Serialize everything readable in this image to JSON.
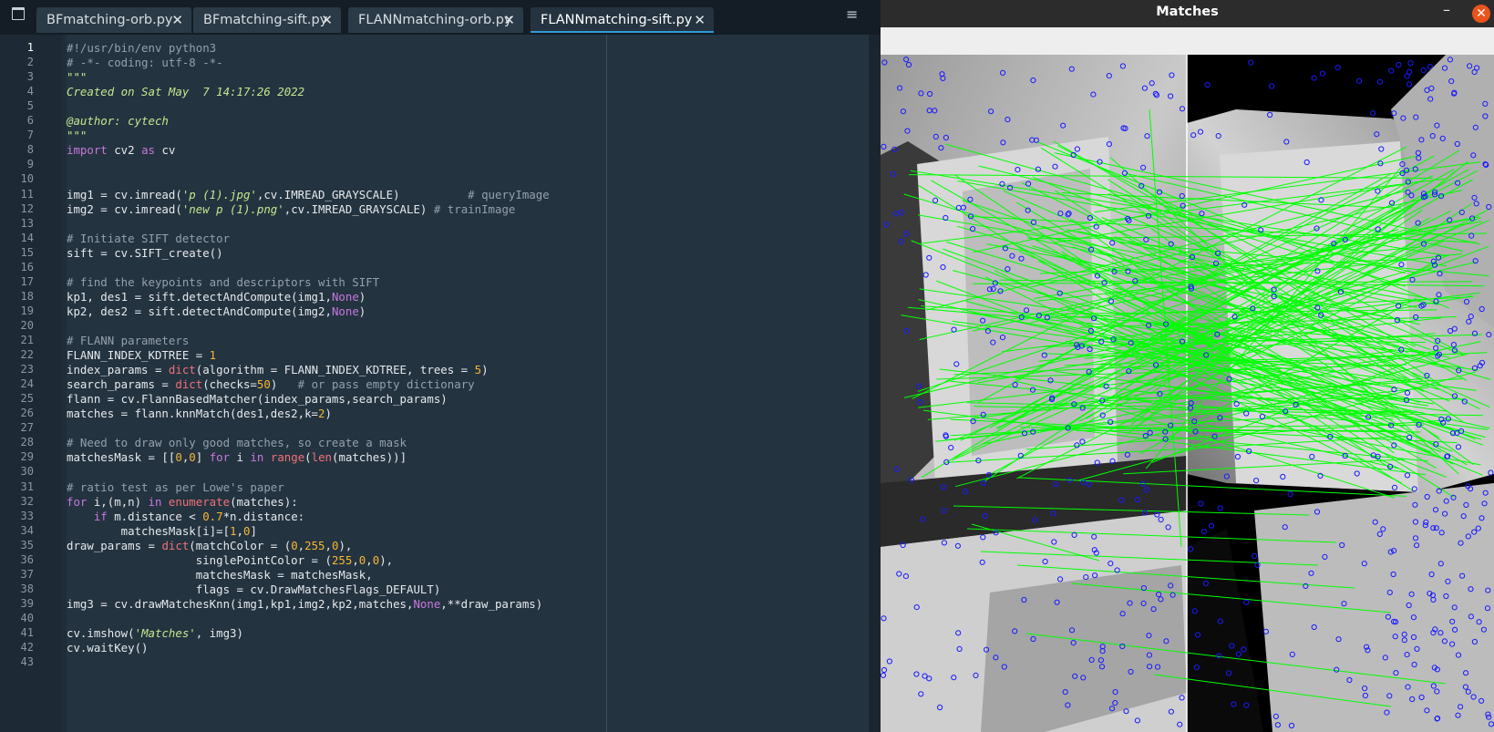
{
  "editor": {
    "tabs": [
      {
        "label": "BFmatching-orb.py",
        "close": "✕"
      },
      {
        "label": "BFmatching-sift.py",
        "close": "✕"
      },
      {
        "label": "FLANNmatching-orb.py",
        "close": "✕"
      },
      {
        "label": "FLANNmatching-sift.py",
        "close": "✕"
      }
    ],
    "active_tab": 3,
    "current_line": 1,
    "lines": [
      "#!/usr/bin/env python3",
      "# -*- coding: utf-8 -*-",
      "\"\"\"",
      "Created on Sat May  7 14:17:26 2022",
      "",
      "@author: cytech",
      "\"\"\"",
      "import cv2 as cv",
      "",
      "",
      "img1 = cv.imread('p (1).jpg',cv.IMREAD_GRAYSCALE)          # queryImage",
      "img2 = cv.imread('new p (1).png',cv.IMREAD_GRAYSCALE) # trainImage",
      "",
      "# Initiate SIFT detector",
      "sift = cv.SIFT_create()",
      "",
      "# find the keypoints and descriptors with SIFT",
      "kp1, des1 = sift.detectAndCompute(img1,None)",
      "kp2, des2 = sift.detectAndCompute(img2,None)",
      "",
      "# FLANN parameters",
      "FLANN_INDEX_KDTREE = 1",
      "index_params = dict(algorithm = FLANN_INDEX_KDTREE, trees = 5)",
      "search_params = dict(checks=50)   # or pass empty dictionary",
      "flann = cv.FlannBasedMatcher(index_params,search_params)",
      "matches = flann.knnMatch(des1,des2,k=2)",
      "",
      "# Need to draw only good matches, so create a mask",
      "matchesMask = [[0,0] for i in range(len(matches))]",
      "",
      "# ratio test as per Lowe's paper",
      "for i,(m,n) in enumerate(matches):",
      "    if m.distance < 0.7*n.distance:",
      "        matchesMask[i]=[1,0]",
      "draw_params = dict(matchColor = (0,255,0),",
      "                   singlePointColor = (255,0,0),",
      "                   matchesMask = matchesMask,",
      "                   flags = cv.DrawMatchesFlags_DEFAULT)",
      "img3 = cv.drawMatchesKnn(img1,kp1,img2,kp2,matches,None,**draw_params)",
      "",
      "cv.imshow('Matches', img3)",
      "cv.waitKey()",
      ""
    ]
  },
  "image_window": {
    "title": "Matches",
    "minimize_label": "–",
    "close_label": "✕",
    "match_color": "#00ff00",
    "keypoint_color": "#1a1aff"
  },
  "icons": {
    "window_menu": "window-icon",
    "hamburger": "≡"
  }
}
